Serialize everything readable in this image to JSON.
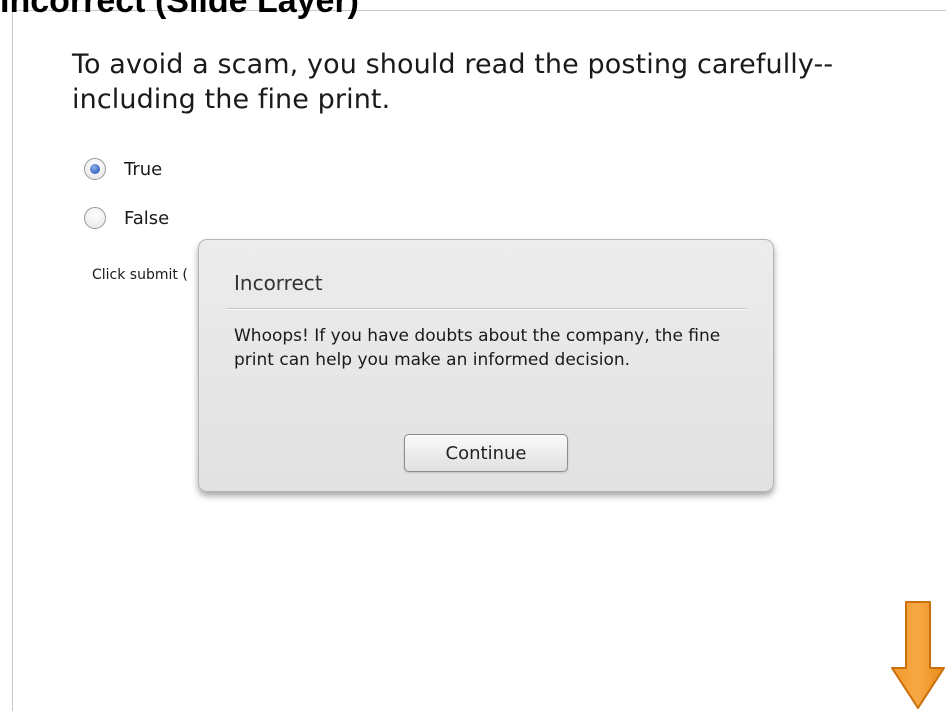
{
  "header": {
    "title": "Incorrect (Slide Layer)"
  },
  "question": {
    "text": "To avoid a scam, you should read the posting carefully--including the fine print.",
    "options": [
      {
        "label": "True",
        "selected": true
      },
      {
        "label": "False",
        "selected": false
      }
    ],
    "hint": "Click submit ("
  },
  "feedback": {
    "title": "Incorrect",
    "message": "Whoops! If you have doubts about the company, the fine print can help you make an informed decision.",
    "continue_label": "Continue"
  },
  "navigation": {
    "next_icon": "down-arrow-icon",
    "arrow_color": "#f7941d"
  }
}
